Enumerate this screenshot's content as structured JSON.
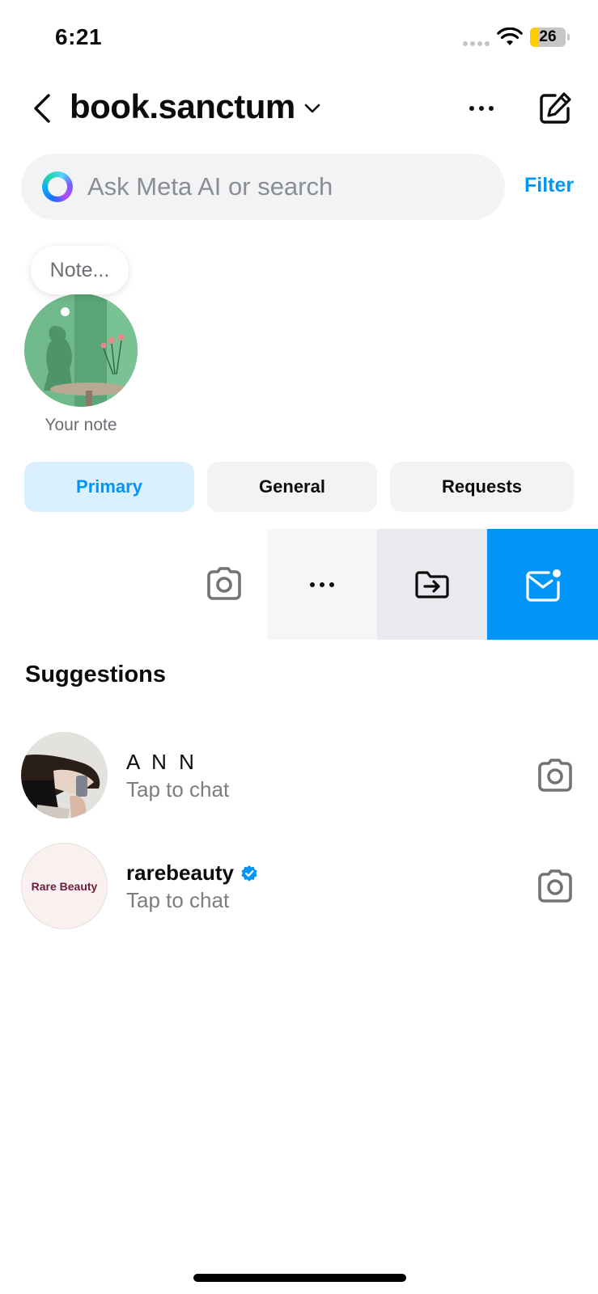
{
  "status_bar": {
    "time": "6:21",
    "battery_percent": 26,
    "battery_label": "26",
    "battery_color": "#ffcc00"
  },
  "header": {
    "back_icon": "chevron-left-icon",
    "title": "book.sanctum",
    "title_dropdown_icon": "chevron-down-icon",
    "more_icon": "ellipsis-icon",
    "compose_icon": "edit-square-icon"
  },
  "search": {
    "icon": "meta-ai-ring-icon",
    "placeholder": "Ask Meta AI or search",
    "value": "",
    "filter_label": "Filter"
  },
  "note": {
    "bubble_text": "Note...",
    "label": "Your note"
  },
  "tabs": [
    {
      "label": "Primary",
      "active": true
    },
    {
      "label": "General",
      "active": false
    },
    {
      "label": "Requests",
      "active": false
    }
  ],
  "swipe_actions": {
    "row_icon": "camera-icon",
    "actions": [
      {
        "name": "more",
        "icon": "ellipsis-icon",
        "bg": "#f5f6f7"
      },
      {
        "name": "move-to-general",
        "icon": "folder-move-icon",
        "bg": "#e8eaed"
      },
      {
        "name": "mark-unread",
        "icon": "mail-unread-icon",
        "bg": "#0095f6"
      }
    ]
  },
  "suggestions": {
    "title": "Suggestions",
    "items": [
      {
        "name": "A N N",
        "subtitle": "Tap to chat",
        "verified": false,
        "avatar_text": ""
      },
      {
        "name": "rarebeauty",
        "subtitle": "Tap to chat",
        "verified": true,
        "avatar_text": "Rare Beauty"
      }
    ]
  },
  "colors": {
    "accent": "#0095f6",
    "active_tab_bg": "#dbf0ff",
    "secondary_text": "#7a7d82"
  }
}
